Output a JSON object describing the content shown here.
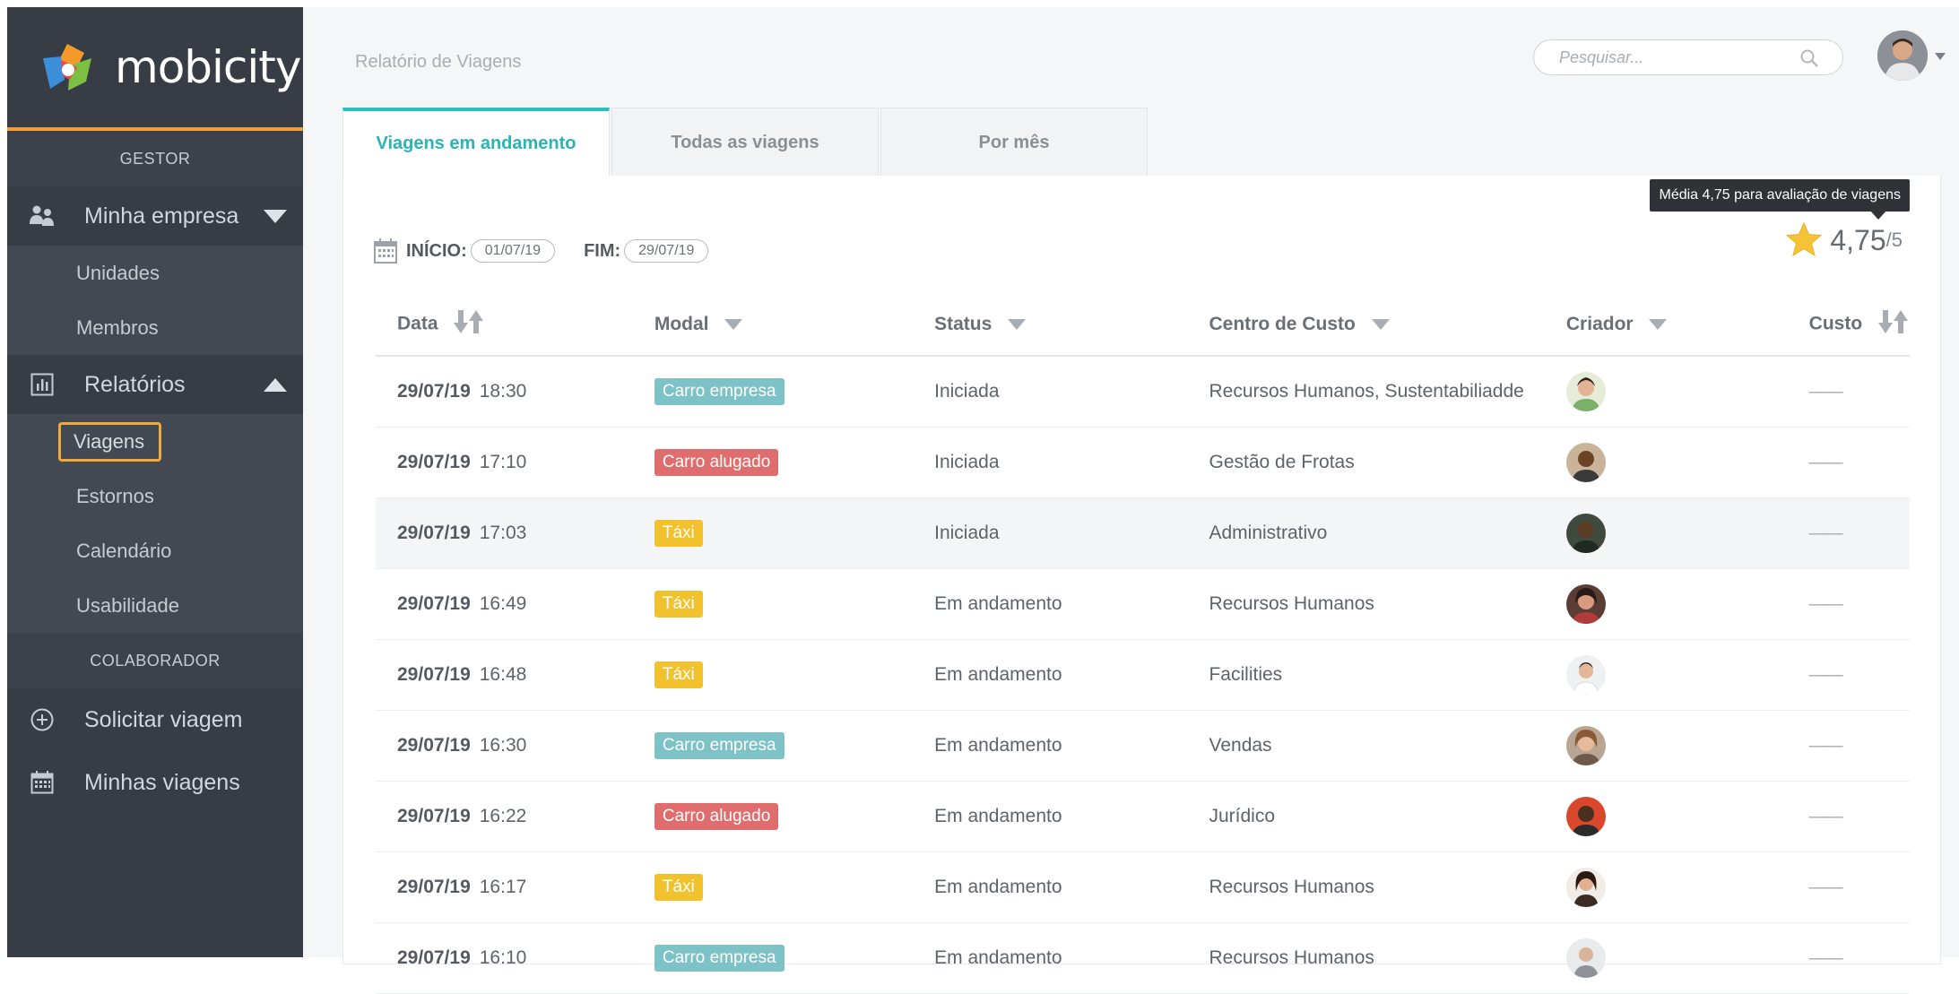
{
  "app": {
    "logo_text": "mobicity"
  },
  "sidebar": {
    "section_gestor": "GESTOR",
    "company_label": "Minha empresa",
    "company_items": [
      "Unidades",
      "Membros"
    ],
    "reports_label": "Relatórios",
    "report_items": [
      "Viagens",
      "Estornos",
      "Calendário",
      "Usabilidade"
    ],
    "active_item": "Viagens",
    "section_colaborador": "COLABORADOR",
    "request_label": "Solicitar viagem",
    "my_trips_label": "Minhas viagens"
  },
  "header": {
    "breadcrumb": "Relatório de Viagens",
    "search_placeholder": "Pesquisar..."
  },
  "tabs": [
    "Viagens em andamento",
    "Todas as viagens",
    "Por mês"
  ],
  "active_tab": "Viagens em andamento",
  "filters": {
    "start_label": "INÍCIO:",
    "start_value": "01/07/19",
    "end_label": "FIM:",
    "end_value": "29/07/19"
  },
  "rating": {
    "tooltip": "Média 4,75 para avaliação de viagens",
    "value": "4,75",
    "max": "/5"
  },
  "table": {
    "columns": [
      "Data",
      "Modal",
      "Status",
      "Centro de Custo",
      "Criador",
      "Custo"
    ],
    "rows": [
      {
        "date": "29/07/19",
        "time": "18:30",
        "modal": "Carro empresa",
        "status": "Iniciada",
        "cost_center": "Recursos Humanos, Sustentabiliadde",
        "cost": "——"
      },
      {
        "date": "29/07/19",
        "time": "17:10",
        "modal": "Carro alugado",
        "status": "Iniciada",
        "cost_center": "Gestão de Frotas",
        "cost": "——"
      },
      {
        "date": "29/07/19",
        "time": "17:03",
        "modal": "Táxi",
        "status": "Iniciada",
        "cost_center": "Administrativo",
        "cost": "——"
      },
      {
        "date": "29/07/19",
        "time": "16:49",
        "modal": "Táxi",
        "status": "Em andamento",
        "cost_center": "Recursos Humanos",
        "cost": "——"
      },
      {
        "date": "29/07/19",
        "time": "16:48",
        "modal": "Táxi",
        "status": "Em andamento",
        "cost_center": "Facilities",
        "cost": "——"
      },
      {
        "date": "29/07/19",
        "time": "16:30",
        "modal": "Carro empresa",
        "status": "Em andamento",
        "cost_center": "Vendas",
        "cost": "——"
      },
      {
        "date": "29/07/19",
        "time": "16:22",
        "modal": "Carro alugado",
        "status": "Em andamento",
        "cost_center": "Jurídico",
        "cost": "——"
      },
      {
        "date": "29/07/19",
        "time": "16:17",
        "modal": "Táxi",
        "status": "Em andamento",
        "cost_center": "Recursos Humanos",
        "cost": "——"
      },
      {
        "date": "29/07/19",
        "time": "16:10",
        "modal": "Carro empresa",
        "status": "Em andamento",
        "cost_center": "Recursos Humanos",
        "cost": "——"
      }
    ]
  },
  "colors": {
    "accent": "#2bb3b5",
    "sidebar_bg": "#373c45",
    "highlight": "#f2a93b",
    "badge_carro_empresa": "#7cc2c6",
    "badge_carro_alugado": "#e06d6d",
    "badge_taxi": "#f2c12e"
  }
}
